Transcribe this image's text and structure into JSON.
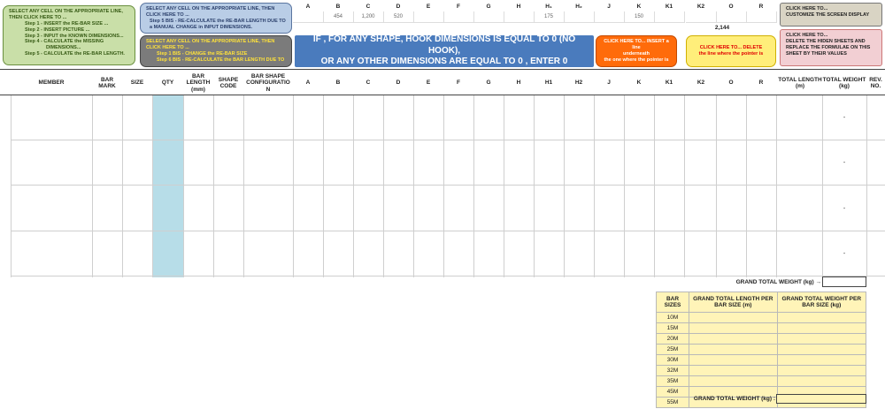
{
  "instructions": {
    "left_button": {
      "heading": "SELECT ANY CELL ON THE APPROPRIATE LINE, THEN CLICK HERE TO ...",
      "steps": [
        "Step 1 - INSERT the RE-BAR SIZE ...",
        "Step 2 - INSERT PICTURE ...",
        "Step 3 - INPUT the KNOWN DIMENSIONS...",
        "Step 4 - CALCULATE the MISSING",
        "DIMENSIONS...",
        "Step 5 - CALCULATE the RE-BAR LENGTH."
      ]
    },
    "blue_button": {
      "heading": "SELECT ANY CELL ON THE APPROPRIATE LINE, THEN CLICK HERE TO ...",
      "step": "Step 5 BIS - RE-CALCULATE the RE-BAR LENGTH DUE TO a MANUAL CHANGE in INPUT DIMENSIONS."
    },
    "gray_button": {
      "heading": "SELECT ANY CELL ON THE APPROPRIATE LINE, THEN CLICK HERE TO ...",
      "step1": "Step 1 BIS - CHANGE the RE-BAR SIZE",
      "step2": "Step 6 BIS - RE-CALCULATE the BAR LENGTH DUE TO"
    },
    "banner": {
      "line1": "IF , FOR ANY SHAPE, HOOK DIMENSIONS IS EQUAL TO 0 (NO HOOK),",
      "line2": "OR ANY OTHER DIMENSIONS ARE EQUAL TO 0 , ENTER 0"
    },
    "insert_button": {
      "line1": "CLICK HERE TO... INSERT a line",
      "line2": "underneath",
      "line3": "the one where the pointer is"
    },
    "delete_button": {
      "line1": "CLICK HERE TO... DELETE",
      "line2": "the line where the pointer is"
    },
    "customize_button": {
      "line1": "CLICK HERE TO...",
      "line2": "CUSTOMIZE THE SCREEN DISPLAY"
    },
    "hidden_button": {
      "line1": "CLICK HERE TO...",
      "line2": "DELETE THE HIDEN SHEETS AND REPLACE THE FORMULAE ON THIS SHEET BY THEIR VALUES"
    }
  },
  "dimension_header": {
    "letters": [
      "A",
      "B",
      "C",
      "D",
      "E",
      "F",
      "G",
      "H",
      "H₁",
      "H₂",
      "J",
      "K",
      "K1",
      "K2",
      "O",
      "R"
    ],
    "values": [
      "",
      "454",
      "1,200",
      "520",
      "",
      "",
      "",
      "",
      "175",
      "",
      "",
      "150",
      "",
      "",
      "",
      ""
    ],
    "o_total": "2,144"
  },
  "columns": {
    "member": "MEMBER",
    "bar_mark": "BAR MARK",
    "size": "SIZE",
    "qty": "QTY",
    "bar_length": "BAR LENGTH (mm)",
    "shape_code": "SHAPE CODE",
    "shape_config": "BAR SHAPE CONFIGURATIO N",
    "dims": [
      "A",
      "B",
      "C",
      "D",
      "E",
      "F",
      "G",
      "H",
      "H1",
      "H2",
      "J",
      "K",
      "K1",
      "K2",
      "O",
      "R"
    ],
    "total_length": "TOTAL LENGTH (m)",
    "total_weight": "TOTAL WEIGHT (kg)",
    "rev": "REV. NO."
  },
  "rows": [
    {
      "total_weight": "-"
    },
    {
      "total_weight": "-"
    },
    {
      "total_weight": "-"
    },
    {
      "total_weight": "-"
    }
  ],
  "grand_total": {
    "label": "GRAND TOTAL WEIGHT (kg) →",
    "value": ""
  },
  "summary": {
    "headers": [
      "BAR SIZES",
      "GRAND TOTAL LENGTH PER BAR SIZE (m)",
      "GRAND TOTAL WEIGHT PER BAR SIZE (kg)"
    ],
    "sizes": [
      "10M",
      "15M",
      "20M",
      "25M",
      "30M",
      "32M",
      "35M",
      "45M",
      "55M"
    ],
    "footer_label": "GRAND TOTAL WEIGHT (kg) :"
  },
  "colors": {
    "qty_fill": "#b7dde8",
    "banner": "#4a7bbd",
    "summary_fill": "#fff4b8"
  }
}
